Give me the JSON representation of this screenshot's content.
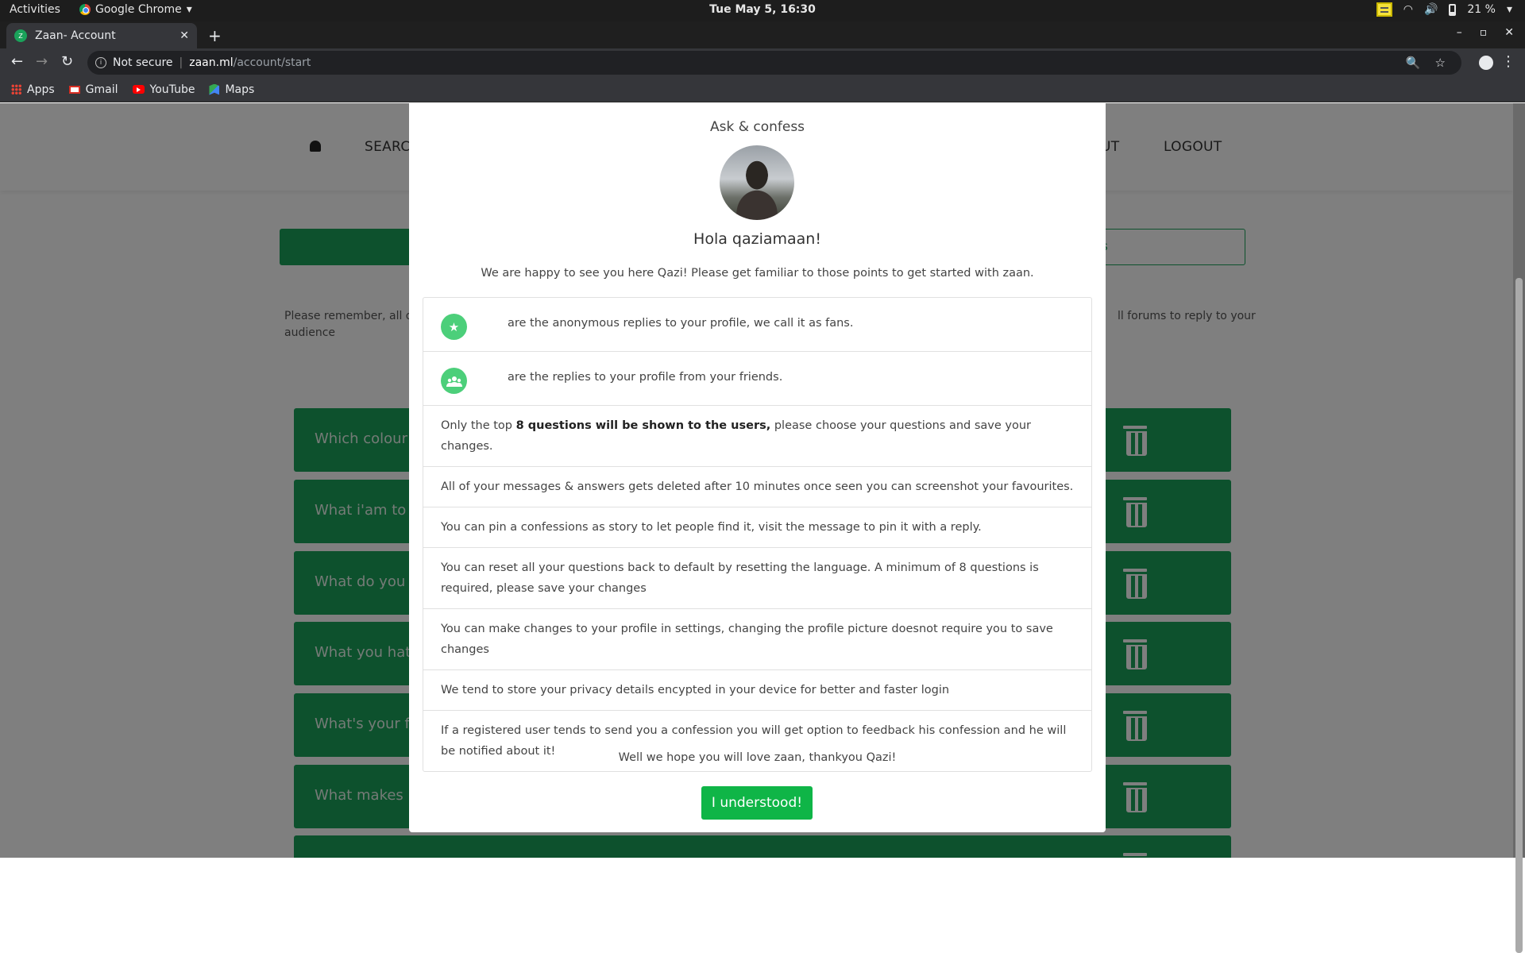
{
  "os": {
    "activities": "Activities",
    "app_name": "Google Chrome",
    "clock": "Tue May  5, 16:30",
    "battery": "21 %"
  },
  "browser": {
    "tab_title": "Zaan- Account",
    "tab_favicon": "Z",
    "security": "Not secure",
    "url_host": "zaan.ml",
    "url_path": "/account/start",
    "bookmarks": [
      "Apps",
      "Gmail",
      "YouTube",
      "Maps"
    ]
  },
  "site": {
    "nav": {
      "search": "SEARCH",
      "about_partial": "UT",
      "logout": "LOGOUT"
    },
    "outline_button_partial": "s",
    "note_left": "Please remember, all of",
    "note_left_2": "audience",
    "note_right": "ll forums to reply to your",
    "questions": [
      "Which colour s",
      "What i'am to y",
      "What do you li",
      "What you hate",
      "What's your fa",
      "What makes m",
      ""
    ]
  },
  "modal": {
    "title": "Ask & confess",
    "greeting": "Hola qaziamaan!",
    "intro": "We are happy to see you here Qazi! Please get familiar to those points to get started with zaan.",
    "icon_items": [
      {
        "icon": "star-icon",
        "glyph": "★",
        "text": "are the anonymous replies to your profile, we call it as fans."
      },
      {
        "icon": "friends-icon",
        "glyph": "👥",
        "text": "are the replies to your profile from your friends."
      }
    ],
    "top_questions": {
      "before": "Only the top ",
      "bold": "8 questions will be shown to the users,",
      "after": " please choose your questions and save your changes."
    },
    "points": [
      "All of your messages & answers gets deleted after 10 minutes once seen you can screenshot your favourites.",
      "You can pin a confessions as story to let people find it, visit the message to pin it with a reply.",
      "You can reset all your questions back to default by resetting the language. A minimum of 8 questions is required, please save your changes",
      "You can make changes to your profile in settings, changing the profile picture doesnot require you to save changes",
      "We tend to store your privacy details encypted in your device for better and faster login",
      "If a registered user tends to send you a confession you will get option to feedback his confession and he will be notified about it!"
    ],
    "outro": "Well we hope you will love zaan, thankyou Qazi!",
    "button": "I understood!"
  },
  "colors": {
    "brand_green": "#1aa25a",
    "button_green": "#0fb547",
    "icon_green": "#4ccf7a"
  }
}
